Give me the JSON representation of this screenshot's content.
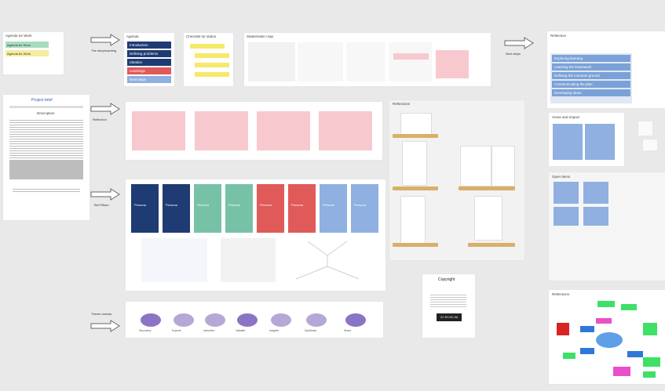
{
  "frames": {
    "f1_title": "Agenda for Work",
    "f1_items": [
      "Agenda for Work",
      "Agenda for Work"
    ],
    "f2_title": "Agenda",
    "f3_title": "Checklist for status",
    "f4_title": "Stakeholder map",
    "work_title": "Stakeholders",
    "copyright_title": "Copyright",
    "shelf_title": "Reflections",
    "persona_title": "Personas",
    "right_top_title": "Reflection",
    "right_mid_title": "Areas and Impact",
    "right_low_title": "Open Items",
    "right_bottom_title": "Reflections"
  },
  "arrow_labels": {
    "a1": "The storyboarding",
    "a2": "Reflection",
    "a3": "Bell Pillars",
    "a4": "Theme canvas",
    "a5": "Next steps"
  },
  "left_doc": {
    "title": "Project brief",
    "section2": "Description"
  },
  "agenda_rows": [
    "Introduction",
    "Defining problems",
    "Ideation",
    "Learnings",
    "Next steps"
  ],
  "right_rows": [
    "Exploring learning",
    "Learning the framework",
    "Defining the common ground",
    "Communicating the plan",
    "Developing ideas"
  ],
  "persona_cards": [
    {
      "label": "Persona",
      "color": "#1f3b73"
    },
    {
      "label": "Persona",
      "color": "#1f3b73"
    },
    {
      "label": "Persona",
      "color": "#77c2a6"
    },
    {
      "label": "Persona",
      "color": "#77c2a6"
    },
    {
      "label": "Persona",
      "color": "#e05a5a"
    },
    {
      "label": "Persona",
      "color": "#e05a5a"
    },
    {
      "label": "Persona",
      "color": "#8fb0e0"
    },
    {
      "label": "Persona",
      "color": "#8fb0e0"
    }
  ],
  "ovals": [
    "Discovery",
    "Explore",
    "Interview",
    "Validate",
    "Insights",
    "Synthesis",
    "Share"
  ],
  "copyright_badge": "CC BY-NC-SA"
}
